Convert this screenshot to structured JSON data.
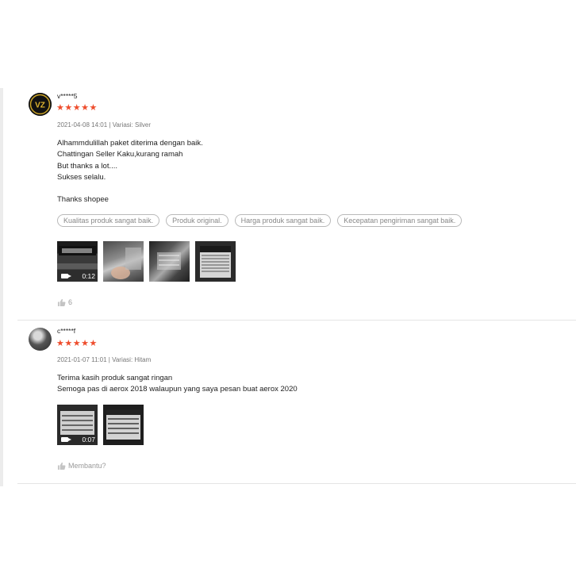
{
  "colors": {
    "star": "#ee4d2d",
    "divider": "#e5e5e5",
    "muted": "#777777"
  },
  "reviews": [
    {
      "username": "v*****5",
      "stars": "★★★★★",
      "meta": "2021-04-08 14:01 | Variasi: Silver",
      "comment_lines": [
        "Alhammdulillah paket diterima dengan baik.",
        "Chattingan Seller Kaku,kurang ramah",
        "But thanks a lot....",
        "Sukses selalu.",
        "",
        "Thanks shopee"
      ],
      "tags": [
        "Kualitas produk sangat baik.",
        "Produk original.",
        "Harga produk sangat baik.",
        "Kecepatan pengiriman sangat baik."
      ],
      "video_duration": "0:12",
      "helpful_count": "6",
      "avatar_text": "VZ"
    },
    {
      "username": "c*****f",
      "stars": "★★★★★",
      "meta": "2021-01-07 11:01 | Variasi: Hitam",
      "comment_lines": [
        "Terima kasih produk sangat ringan",
        "Semoga pas di aerox 2018 walaupun yang saya pesan buat aerox 2020"
      ],
      "video_duration": "0:07",
      "helpful_label": "Membantu?"
    }
  ]
}
